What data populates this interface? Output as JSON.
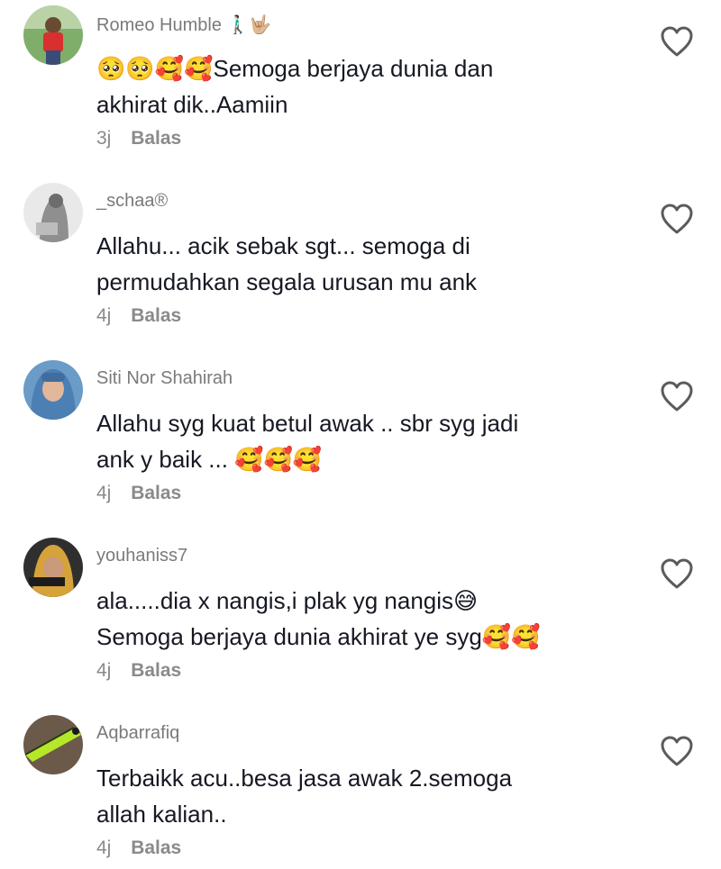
{
  "comments": [
    {
      "author": "Romeo Humble 🚶🏻‍♂️🤟🏼",
      "text": "🥺🥺🥰🥰Semoga berjaya dunia dan\nakhirat dik..Aamiin",
      "time": "3j",
      "reply_label": "Balas"
    },
    {
      "author": "_schaa®",
      "text": "Allahu... acik sebak sgt... semoga di\npermudahkan segala urusan mu ank",
      "time": "4j",
      "reply_label": "Balas"
    },
    {
      "author": "Siti Nor Shahirah",
      "text": "Allahu syg kuat betul awak .. sbr syg jadi\nank y baik ... 🥰🥰🥰",
      "time": "4j",
      "reply_label": "Balas"
    },
    {
      "author": "youhaniss7",
      "text": "ala.....dia x nangis,i plak yg nangis😅\nSemoga berjaya dunia akhirat ye syg🥰🥰",
      "time": "4j",
      "reply_label": "Balas"
    },
    {
      "author": "Aqbarrafiq",
      "text": "Terbaikk acu..besa jasa awak 2.semoga\nallah kalian..",
      "time": "4j",
      "reply_label": "Balas"
    }
  ],
  "icons": {
    "like": "heart-outline-icon"
  }
}
